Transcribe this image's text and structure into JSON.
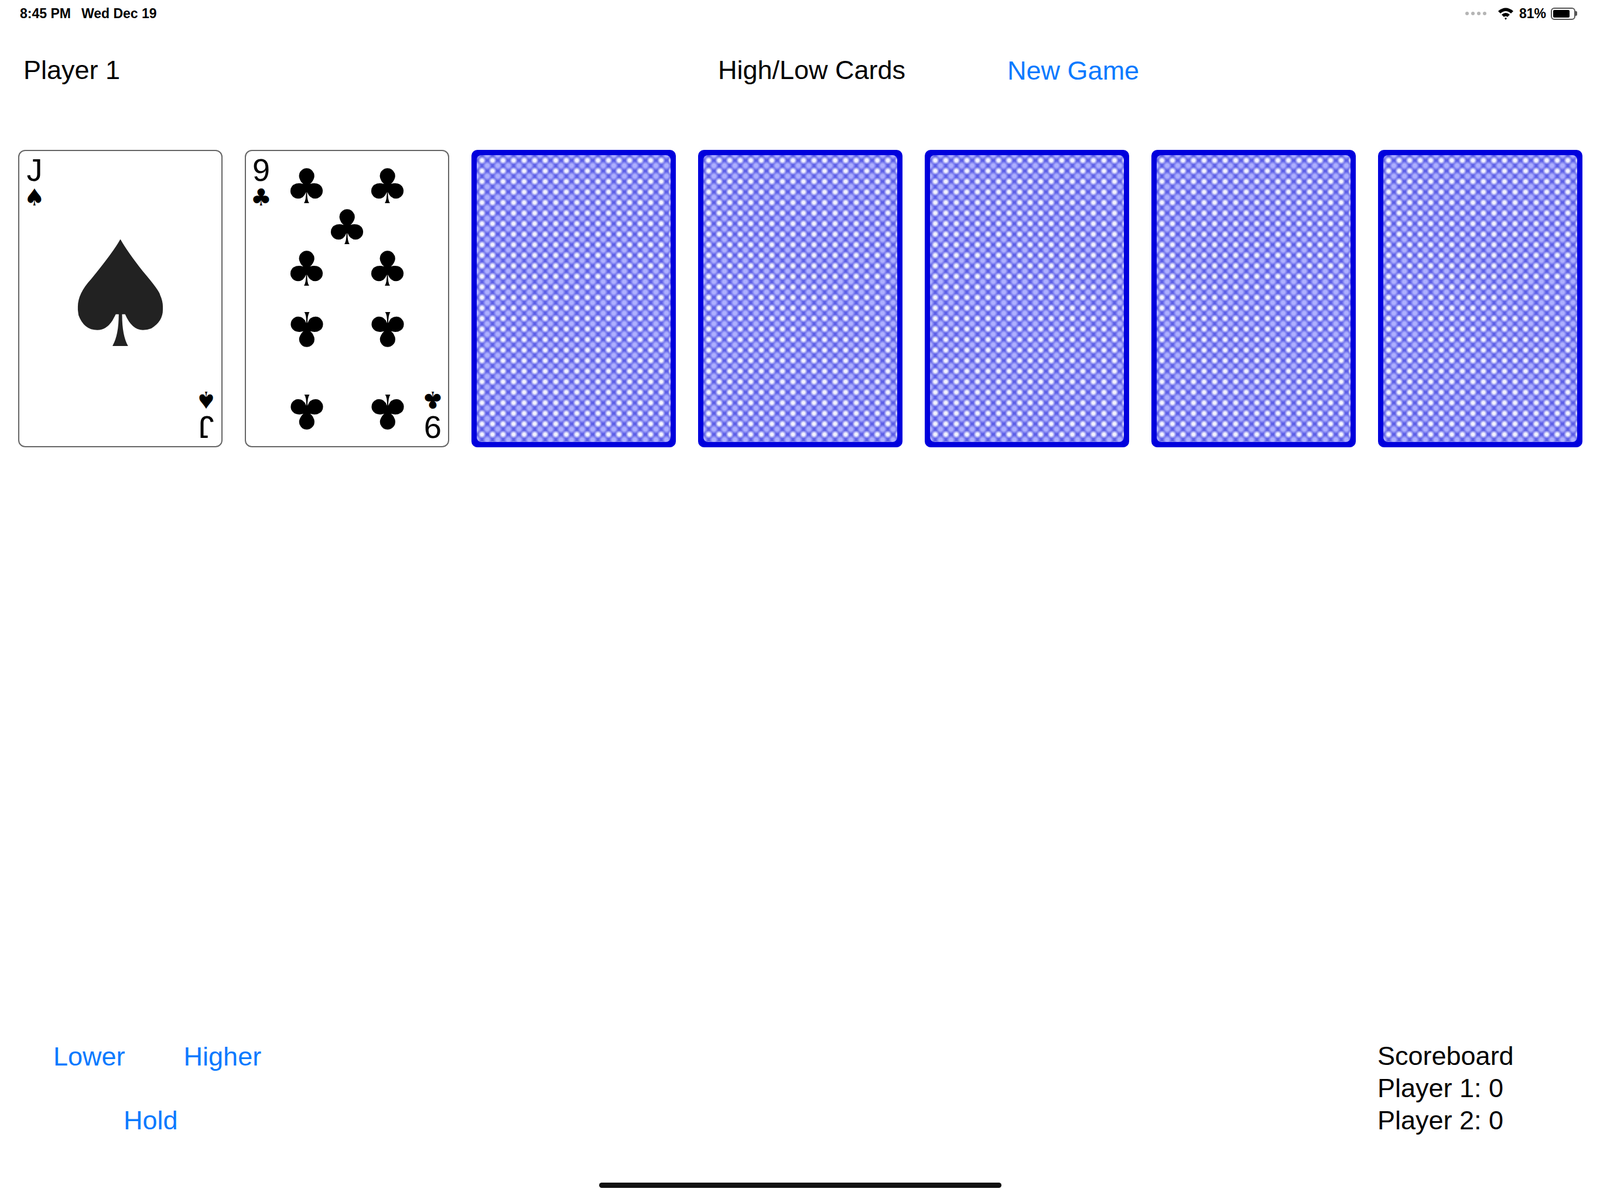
{
  "status_bar": {
    "time": "8:45 PM",
    "date": "Wed Dec 19",
    "battery": "81%",
    "battery_level": 0.81
  },
  "header": {
    "player": "Player 1",
    "title": "High/Low Cards",
    "new_game": "New Game"
  },
  "cards": [
    {
      "kind": "face",
      "rank": "J",
      "suit": "♠"
    },
    {
      "kind": "face",
      "rank": "9",
      "suit": "♣"
    },
    {
      "kind": "back"
    },
    {
      "kind": "back"
    },
    {
      "kind": "back"
    },
    {
      "kind": "back"
    },
    {
      "kind": "back"
    }
  ],
  "controls": [
    "Lower",
    "Higher",
    "Hold"
  ],
  "scoreboard": {
    "title": "Scoreboard",
    "lines": [
      "Player 1: 0",
      "Player 2: 0"
    ]
  }
}
